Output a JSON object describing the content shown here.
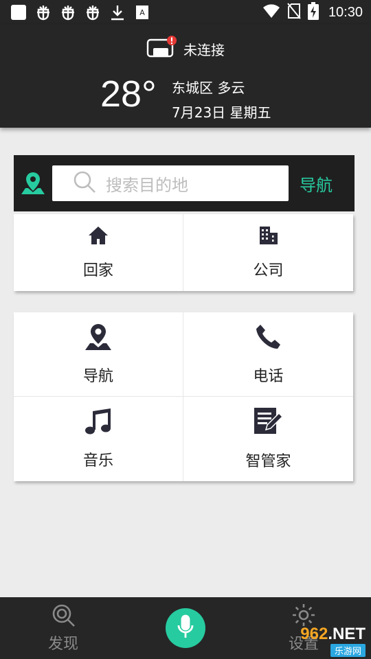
{
  "status_bar": {
    "time": "10:30",
    "left_icons": [
      "square-notification-icon",
      "bug-icon",
      "bug-icon",
      "bug-icon",
      "download-icon",
      "text-input-icon"
    ],
    "right_icons": [
      "wifi-icon",
      "no-sim-icon",
      "battery-charging-icon"
    ]
  },
  "header": {
    "connection_status": "未连接",
    "temperature": "28°",
    "location_weather": "东城区 多云",
    "date": "7月23日 星期五"
  },
  "search": {
    "placeholder": "搜索目的地",
    "nav_button": "导航"
  },
  "quick_destinations": [
    {
      "label": "回家",
      "icon": "home-icon"
    },
    {
      "label": "公司",
      "icon": "office-building-icon"
    }
  ],
  "features": [
    {
      "label": "导航",
      "icon": "navigation-pin-icon"
    },
    {
      "label": "电话",
      "icon": "phone-icon"
    },
    {
      "label": "音乐",
      "icon": "music-note-icon"
    },
    {
      "label": "智管家",
      "icon": "notepad-icon"
    }
  ],
  "bottom_nav": {
    "discover": "发现",
    "settings": "设置"
  },
  "watermark": {
    "brand_num": "962",
    "brand_suffix": ".NET",
    "sub": "乐游网"
  },
  "colors": {
    "accent": "#27cba0",
    "dark": "#262626",
    "background": "#ececec",
    "alert": "#e53935"
  }
}
